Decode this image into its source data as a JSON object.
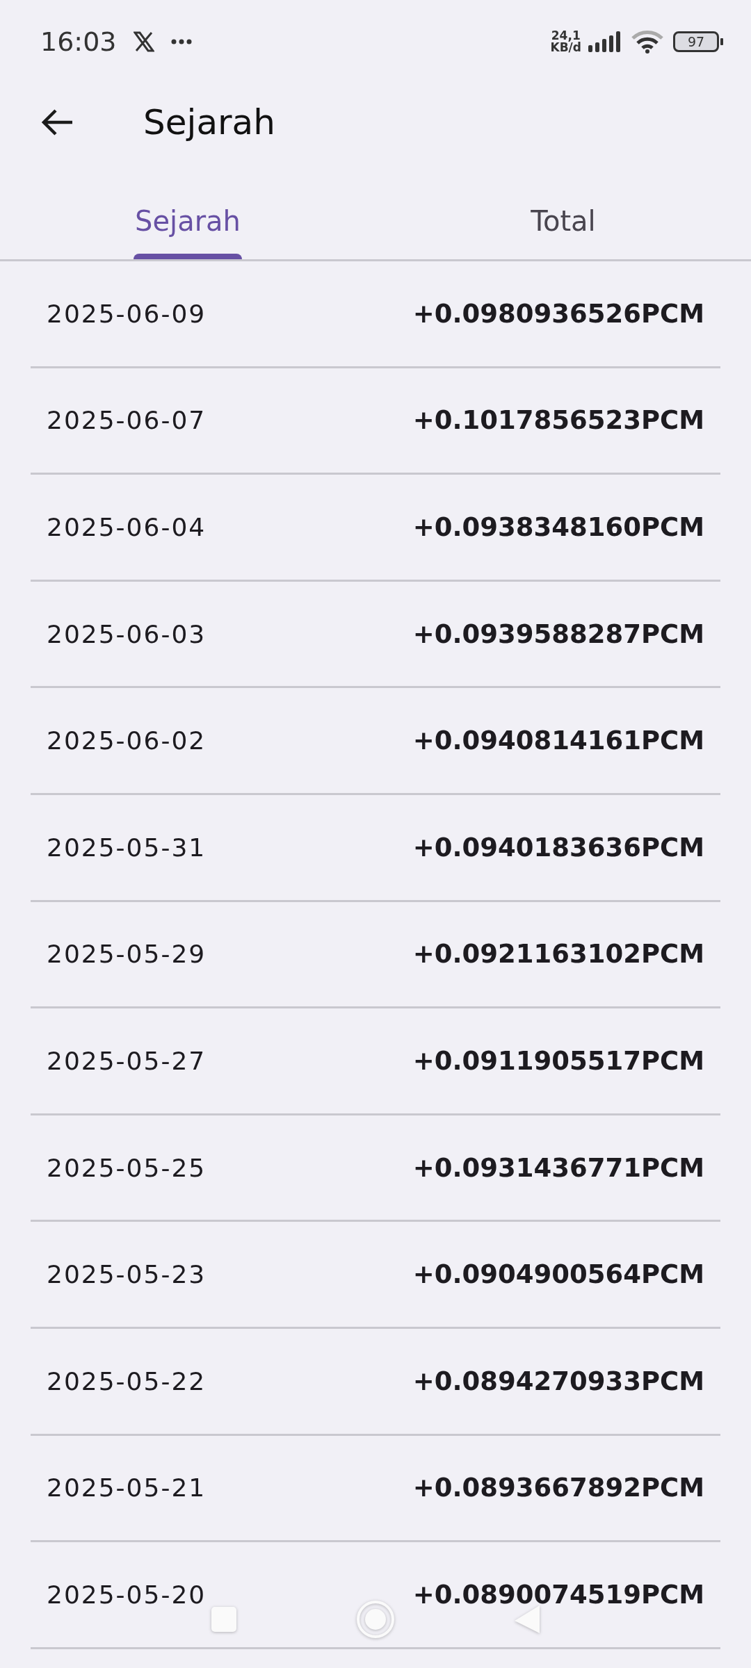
{
  "status_bar": {
    "time": "16:03",
    "data_rate": "24,1",
    "data_unit": "KB/d",
    "battery": "97"
  },
  "header": {
    "title": "Sejarah"
  },
  "tabs": [
    {
      "label": "Sejarah",
      "selected": true
    },
    {
      "label": "Total",
      "selected": false
    }
  ],
  "rows": [
    {
      "date": "2025-06-09",
      "amount": "+0.0980936526PCM"
    },
    {
      "date": "2025-06-07",
      "amount": "+0.1017856523PCM"
    },
    {
      "date": "2025-06-04",
      "amount": "+0.0938348160PCM"
    },
    {
      "date": "2025-06-03",
      "amount": "+0.0939588287PCM"
    },
    {
      "date": "2025-06-02",
      "amount": "+0.0940814161PCM"
    },
    {
      "date": "2025-05-31",
      "amount": "+0.0940183636PCM"
    },
    {
      "date": "2025-05-29",
      "amount": "+0.0921163102PCM"
    },
    {
      "date": "2025-05-27",
      "amount": "+0.0911905517PCM"
    },
    {
      "date": "2025-05-25",
      "amount": "+0.0931436771PCM"
    },
    {
      "date": "2025-05-23",
      "amount": "+0.0904900564PCM"
    },
    {
      "date": "2025-05-22",
      "amount": "+0.0894270933PCM"
    },
    {
      "date": "2025-05-21",
      "amount": "+0.0893667892PCM"
    },
    {
      "date": "2025-05-20",
      "amount": "+0.0890074519PCM"
    }
  ]
}
